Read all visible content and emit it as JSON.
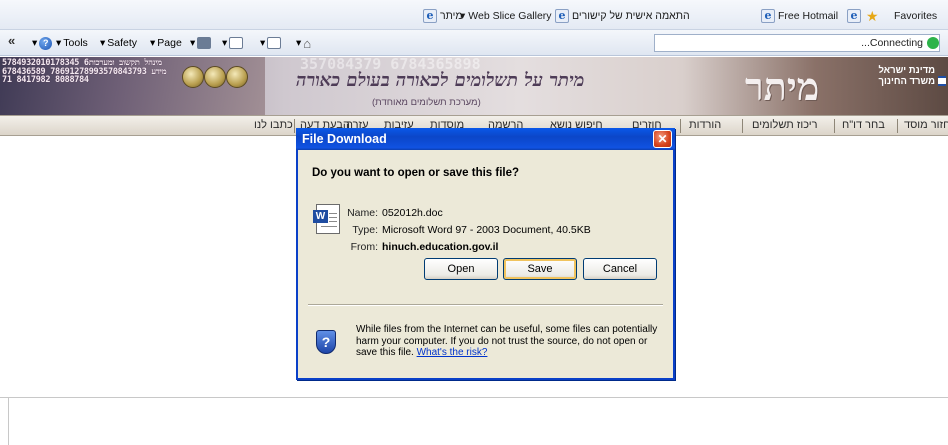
{
  "favorites_bar": {
    "favorites_label": "Favorites",
    "hotmail_label": "Free Hotmail",
    "personal_label": "התאמה אישית של קישורים",
    "webslice_label": "Web Slice Gallery",
    "mitar_label": "מיתר"
  },
  "command_bar": {
    "tools_label": "Tools",
    "safety_label": "Safety",
    "page_label": "Page",
    "status_text": "...Connecting"
  },
  "banner": {
    "digits": "5784932010178345 6מינהל תקשוב ומערכות מידע 78691278993570843793 6784365898088784 8417982 71",
    "ghost_digits": "357084379 6784365898",
    "slogan": "מיתר על תשלומים לכאורה בעולם כאורה",
    "subtitle": "(מערכת תשלומים מאוחדת)",
    "logo": "מיתר",
    "ministry_line1": "מדינת ישראל",
    "ministry_line2": "משרד החינוך"
  },
  "nav": {
    "items": [
      "כתבו לנו",
      "הבעת דעה",
      "עזרה",
      "עזיבות",
      "מוסדות",
      "הרשמה",
      "חיפוש נושא",
      "חוזרים",
      "הורדות",
      "ריכוז תשלומים",
      "בחר דו\"ח",
      "חזור מוסד"
    ]
  },
  "dialog": {
    "title": "File Download",
    "question": "Do you want to open or save this file?",
    "name_label": "Name:",
    "name_value": "052012h.doc",
    "type_label": "Type:",
    "type_value": "Microsoft Word 97 - 2003 Document, 40.5KB",
    "from_label": "From:",
    "from_value": "hinuch.education.gov.il",
    "open_label": "Open",
    "save_label": "Save",
    "cancel_label": "Cancel",
    "warning_text": "While files from the Internet can be useful, some files can potentially harm your computer. If you do not trust the source, do not open or save this file.",
    "risk_link": "What's the risk?"
  }
}
